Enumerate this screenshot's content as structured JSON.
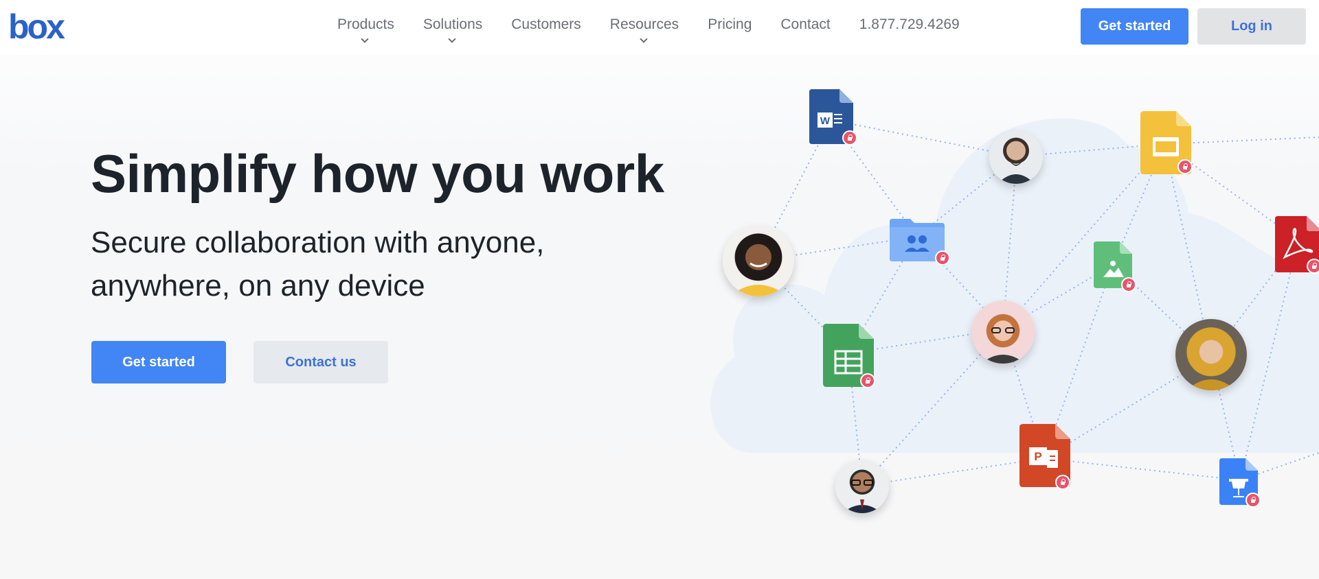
{
  "header": {
    "logo": "box",
    "nav": [
      {
        "label": "Products",
        "dropdown": true
      },
      {
        "label": "Solutions",
        "dropdown": true
      },
      {
        "label": "Customers",
        "dropdown": false
      },
      {
        "label": "Resources",
        "dropdown": true
      },
      {
        "label": "Pricing",
        "dropdown": false
      },
      {
        "label": "Contact",
        "dropdown": false
      },
      {
        "label": "1.877.729.4269",
        "dropdown": false
      }
    ],
    "get_started_label": "Get started",
    "login_label": "Log in"
  },
  "hero": {
    "title": "Simplify how you work",
    "subtitle": "Secure collaboration with anyone, anywhere, on any device",
    "primary_cta": "Get started",
    "secondary_cta": "Contact us"
  },
  "illustration": {
    "file_icons": [
      {
        "type": "word",
        "letter": "W",
        "color": "#2b579a"
      },
      {
        "type": "slides",
        "color": "#f4b400"
      },
      {
        "type": "shared-folder",
        "color": "#6fa5f5"
      },
      {
        "type": "image",
        "color": "#5fbf7a"
      },
      {
        "type": "pdf",
        "color": "#cc2127"
      },
      {
        "type": "sheets",
        "color": "#34a853"
      },
      {
        "type": "powerpoint",
        "letter": "P",
        "color": "#d24726"
      },
      {
        "type": "keynote",
        "color": "#3b82f6"
      }
    ],
    "avatars": [
      "man-beard",
      "woman-curly",
      "man-red-hair",
      "woman-scarf",
      "man-glasses"
    ]
  },
  "colors": {
    "brand": "#2a62c9",
    "primary_button": "#4285f4",
    "secondary_button": "#e6e9ee",
    "lock_badge": "#e8546b",
    "connector": "#8fb3ef"
  }
}
